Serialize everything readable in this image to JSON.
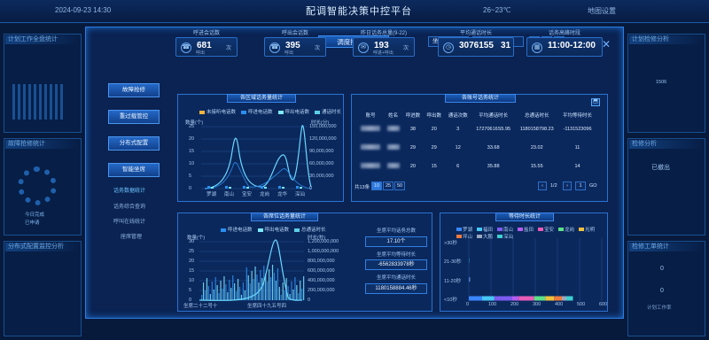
{
  "topbar": {
    "datetime": "2024-09-23 14:30",
    "title": "配调智能决策中控平台",
    "weather": "26~23℃",
    "settings": "地图设置"
  },
  "background": {
    "panels": [
      "计划工作全盘统计",
      "故障抢修统计",
      "检修工单统计",
      "计划检修分析",
      "检修分析",
      "已撤出",
      "分布式配置监控分析"
    ],
    "left_values": [
      "今日完成",
      "已申请"
    ],
    "right_values": [
      "1506",
      "0",
      "0",
      "0"
    ],
    "right_labels": [
      "计划工作率"
    ]
  },
  "modal": {
    "title": "调度控制台",
    "close": "✕",
    "controls": {
      "period_select": "坐席设置",
      "date": "2024-09-23",
      "ranges": [
        "日",
        "月",
        "年"
      ]
    },
    "kpis": [
      {
        "label": "呼进会话数",
        "value": "681",
        "unit": "次",
        "sub": "呼出",
        "icon": "phone-in"
      },
      {
        "label": "呼出会话数",
        "value": "395",
        "unit": "次",
        "sub": "呼出",
        "icon": "phone-out"
      },
      {
        "label": "昨日话务总量(9-22)",
        "value": "193",
        "unit": "次",
        "sub": "呼进+呼出",
        "icon": "chat"
      },
      {
        "label": "平均通话时长",
        "value": "3076155",
        "value2": "31",
        "unit": "",
        "sub": "",
        "icon": "clock"
      },
      {
        "label": "话务高峰时段",
        "value": "11:00-12:00",
        "unit": "",
        "sub": "",
        "icon": "calendar"
      }
    ],
    "nav": {
      "buttons": [
        "故障抢修",
        "重过载管控",
        "分布式配置",
        "智能坐席"
      ],
      "subitems": [
        "话务数据统计",
        "话务综合查询",
        "呼叫在线统计",
        "座席管理"
      ]
    },
    "region_chart": {
      "title": "各区域话务量统计",
      "legend": [
        "未接听电话数",
        "呼进电话数",
        "呼出电话数",
        "通话时长"
      ],
      "legend_colors": [
        "#f0b43c",
        "#2a8ff0",
        "#7de8ff",
        "#5ccfe6"
      ],
      "ylabel_left": "数量(个)",
      "ylabel_right": "时长(分)",
      "yticks_left": [
        "25",
        "20",
        "15",
        "10",
        "5",
        "0"
      ],
      "yticks_right": [
        "150,000,000",
        "120,000,000",
        "90,000,000",
        "60,000,000",
        "30,000,000",
        "0"
      ],
      "xticks": [
        "罗湖",
        "南山",
        "宝安",
        "龙岗",
        "龙华",
        "深汕"
      ]
    },
    "account_table": {
      "title": "各账号话务统计",
      "headers": [
        "账号",
        "姓名",
        "呼进数",
        "呼出数",
        "通话次数",
        "平均通话时长",
        "总通话时长",
        "平均等待时长"
      ],
      "rows": [
        {
          "c3": "38",
          "c4": "20",
          "c5": "3",
          "c6": "17270616S5.95",
          "c7": "1180158798.23",
          "c8": "-1131523096"
        },
        {
          "c3": "29",
          "c4": "29",
          "c5": "12",
          "c6": "33.68",
          "c7": "23.02",
          "c8": "11"
        },
        {
          "c3": "20",
          "c4": "15",
          "c5": "6",
          "c6": "35.88",
          "c7": "15.55",
          "c8": "14"
        }
      ],
      "total": "共13条",
      "page_sizes": [
        "10",
        "25",
        "50"
      ],
      "page_info": "1/2",
      "page_input": "1",
      "go": "GO"
    },
    "seat_chart": {
      "title": "各席位话务量统计",
      "legend": [
        "呼进电话数",
        "呼出电话数",
        "总通话时长"
      ],
      "legend_colors": [
        "#2a8ff0",
        "#7de8ff",
        "#5ccfe6"
      ],
      "ylabel_left": "数量(个)",
      "ylabel_right": "时长(秒)",
      "yticks_left": [
        "30",
        "25",
        "20",
        "15",
        "10",
        "5",
        "0"
      ],
      "yticks_right": [
        "1,200,000,000",
        "1,000,000,000",
        "800,000,000",
        "600,000,000",
        "400,000,000",
        "200,000,000",
        "0"
      ],
      "xticks": [
        "坐席二十二号十",
        "坐席四十九五号四"
      ]
    },
    "seat_stats": [
      {
        "label": "坐席平均话务总数",
        "value": "17.10个"
      },
      {
        "label": "坐席平均等待时长",
        "value": "-6562833978秒"
      },
      {
        "label": "坐席平均通话时长",
        "value": "1180158884.46秒"
      }
    ],
    "wait_chart": {
      "title": "等待时长统计",
      "legend": [
        "罗湖",
        "福田",
        "南山",
        "盐田",
        "宝安",
        "龙岗",
        "光明",
        "坪山",
        "大鹏",
        "深汕"
      ],
      "legend_colors": [
        "#3a86ff",
        "#46c7f5",
        "#7c5cf0",
        "#b35cf0",
        "#e85cb8",
        "#5ce08a",
        "#f0c03c",
        "#f07a3c",
        "#9aa8c0",
        "#3cd0d0"
      ],
      "categories": [
        ">30秒",
        "21-30秒",
        "11-20秒",
        "<10秒"
      ],
      "xticks": [
        "0",
        "100",
        "200",
        "300",
        "400",
        "500",
        "600"
      ],
      "series_values": [
        [
          0,
          1,
          2,
          60
        ],
        [
          0,
          1,
          1,
          55
        ],
        [
          0,
          0,
          1,
          80
        ],
        [
          0,
          0,
          0,
          30
        ],
        [
          0,
          0,
          1,
          70
        ],
        [
          0,
          0,
          1,
          50
        ],
        [
          0,
          0,
          0,
          40
        ],
        [
          0,
          0,
          0,
          35
        ],
        [
          0,
          0,
          0,
          20
        ],
        [
          0,
          0,
          0,
          30
        ]
      ]
    }
  }
}
